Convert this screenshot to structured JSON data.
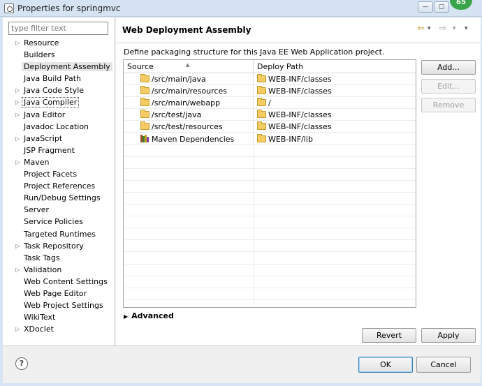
{
  "window": {
    "title": "Properties for springmvc",
    "badge_count": "65",
    "controls": {
      "minimize": "—",
      "maximize": "▢",
      "close": "✕"
    }
  },
  "filter": {
    "placeholder": "type filter text"
  },
  "nav": {
    "items": [
      {
        "label": "Resource",
        "expandable": true
      },
      {
        "label": "Builders",
        "expandable": false
      },
      {
        "label": "Deployment Assembly",
        "expandable": false,
        "selected": true
      },
      {
        "label": "Java Build Path",
        "expandable": false
      },
      {
        "label": "Java Code Style",
        "expandable": true
      },
      {
        "label": "Java Compiler",
        "expandable": true,
        "focused": true
      },
      {
        "label": "Java Editor",
        "expandable": true
      },
      {
        "label": "Javadoc Location",
        "expandable": false
      },
      {
        "label": "JavaScript",
        "expandable": true
      },
      {
        "label": "JSP Fragment",
        "expandable": false
      },
      {
        "label": "Maven",
        "expandable": true
      },
      {
        "label": "Project Facets",
        "expandable": false
      },
      {
        "label": "Project References",
        "expandable": false
      },
      {
        "label": "Run/Debug Settings",
        "expandable": false
      },
      {
        "label": "Server",
        "expandable": false
      },
      {
        "label": "Service Policies",
        "expandable": false
      },
      {
        "label": "Targeted Runtimes",
        "expandable": false
      },
      {
        "label": "Task Repository",
        "expandable": true
      },
      {
        "label": "Task Tags",
        "expandable": false
      },
      {
        "label": "Validation",
        "expandable": true
      },
      {
        "label": "Web Content Settings",
        "expandable": false
      },
      {
        "label": "Web Page Editor",
        "expandable": false
      },
      {
        "label": "Web Project Settings",
        "expandable": false
      },
      {
        "label": "WikiText",
        "expandable": false
      },
      {
        "label": "XDoclet",
        "expandable": true
      }
    ]
  },
  "page": {
    "title": "Web Deployment Assembly",
    "description": "Define packaging structure for this Java EE Web Application project.",
    "history": {
      "back": "⇦",
      "forward": "⇨",
      "menu": "▾"
    }
  },
  "table": {
    "columns": {
      "source": "Source",
      "deploy_path": "Deploy Path"
    },
    "rows": [
      {
        "source": "/src/main/java",
        "deploy": "WEB-INF/classes",
        "icon": "folder"
      },
      {
        "source": "/src/main/resources",
        "deploy": "WEB-INF/classes",
        "icon": "folder"
      },
      {
        "source": "/src/main/webapp",
        "deploy": "/",
        "icon": "folder"
      },
      {
        "source": "/src/test/java",
        "deploy": "WEB-INF/classes",
        "icon": "folder"
      },
      {
        "source": "/src/test/resources",
        "deploy": "WEB-INF/classes",
        "icon": "folder"
      },
      {
        "source": "Maven Dependencies",
        "deploy": "WEB-INF/lib",
        "icon": "library"
      }
    ]
  },
  "buttons": {
    "add": "Add...",
    "edit": "Edit...",
    "remove": "Remove",
    "revert": "Revert",
    "apply": "Apply",
    "ok": "OK",
    "cancel": "Cancel"
  },
  "advanced": {
    "label": "Advanced"
  },
  "help": {
    "glyph": "?"
  },
  "colors": {
    "accent": "#3c7fb1",
    "folder": "#f5cc63",
    "selected_bg": "#e5e5e5"
  }
}
